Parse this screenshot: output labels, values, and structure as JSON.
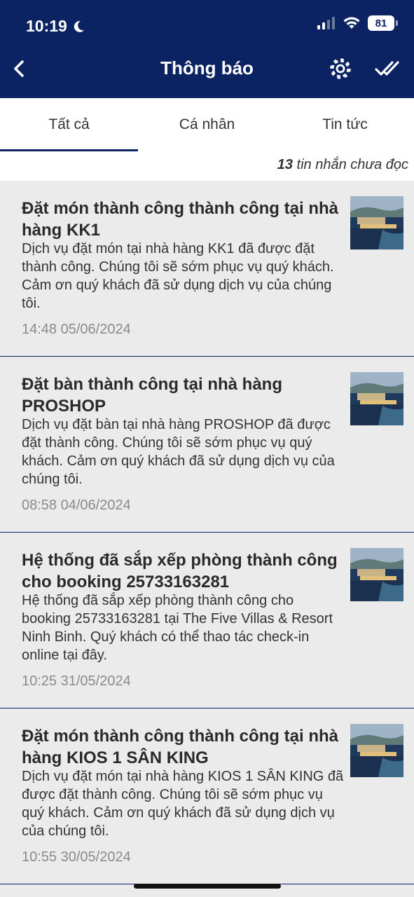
{
  "status_bar": {
    "time": "10:19",
    "battery": "81"
  },
  "header": {
    "title": "Thông báo"
  },
  "tabs": [
    {
      "label": "Tất cả",
      "active": true
    },
    {
      "label": "Cá nhân",
      "active": false
    },
    {
      "label": "Tin tức",
      "active": false
    }
  ],
  "unread": {
    "count": "13",
    "text": "tin nhắn chưa đọc"
  },
  "notifications": [
    {
      "title": "Đặt món thành công thành công tại nhà hàng KK1",
      "body": "Dịch vụ đặt món tại nhà hàng KK1 đã được đặt thành công. Chúng tôi sẽ sớm phục vụ quý khách. Cảm ơn quý khách đã sử dụng dịch vụ của chúng tôi.",
      "time": "14:48 05/06/2024"
    },
    {
      "title": "Đặt bàn thành công tại nhà hàng PROSHOP",
      "body": "Dịch vụ đặt bàn tại nhà hàng PROSHOP đã được đặt thành công. Chúng tôi sẽ sớm phục vụ quý khách. Cảm ơn quý khách đã sử dụng dịch vụ của chúng tôi.",
      "time": "08:58 04/06/2024"
    },
    {
      "title": "Hệ thống đã sắp xếp phòng thành công cho booking 25733163281",
      "body": "Hệ thống đã sắp xếp phòng thành công cho booking 25733163281 tại The Five Villas & Resort Ninh Binh. Quý khách có thể thao tác check-in online tại đây.",
      "time": "10:25 31/05/2024"
    },
    {
      "title": "Đặt món thành công thành công tại nhà hàng KIOS 1 SÂN KING",
      "body": "Dịch vụ đặt món tại nhà hàng KIOS 1 SÂN KING đã được đặt thành công. Chúng tôi sẽ sớm phục vụ quý khách. Cảm ơn quý khách đã sử dụng dịch vụ của chúng tôi.",
      "time": "10:55 30/05/2024"
    }
  ],
  "colors": {
    "header_bg": "#0b2263",
    "tab_indicator": "#0b2263"
  }
}
